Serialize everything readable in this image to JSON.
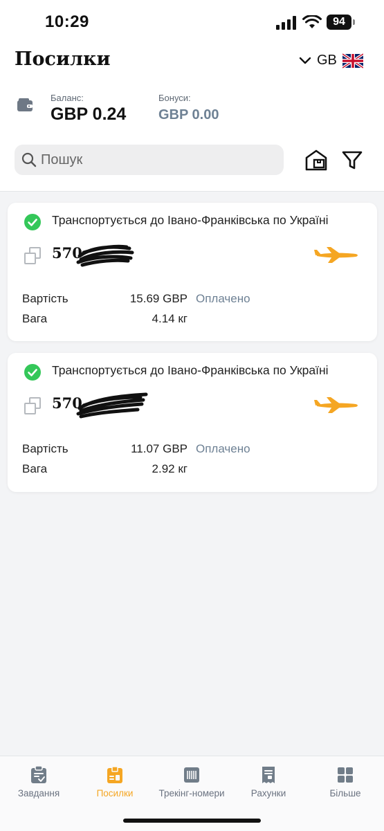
{
  "status_bar": {
    "time": "10:29",
    "battery": "94"
  },
  "header": {
    "title": "Посилки",
    "region_code": "GB"
  },
  "balance": {
    "label": "Баланс:",
    "value": "GBP 0.24"
  },
  "bonuses": {
    "label": "Бонуси:",
    "value": "GBP 0.00"
  },
  "search": {
    "placeholder": "Пошук"
  },
  "colors": {
    "accent": "#f5a623",
    "success": "#34c759",
    "muted": "#6e8194"
  },
  "parcels": [
    {
      "status": "Транспортується до Івано-Франківська по Україні",
      "tracking_visible": "570",
      "cost_label": "Вартість",
      "cost_value": "15.69 GBP",
      "payment_status": "Оплачено",
      "weight_label": "Вага",
      "weight_value": "4.14 кг"
    },
    {
      "status": "Транспортується до Івано-Франківська по Україні",
      "tracking_visible": "570",
      "cost_label": "Вартість",
      "cost_value": "11.07 GBP",
      "payment_status": "Оплачено",
      "weight_label": "Вага",
      "weight_value": "2.92 кг"
    }
  ],
  "tabs": [
    {
      "label": "Завдання",
      "icon": "tasks-icon",
      "active": false
    },
    {
      "label": "Посилки",
      "icon": "parcels-icon",
      "active": true
    },
    {
      "label": "Трекінг-номери",
      "icon": "barcode-icon",
      "active": false
    },
    {
      "label": "Рахунки",
      "icon": "invoice-icon",
      "active": false
    },
    {
      "label": "Більше",
      "icon": "grid-icon",
      "active": false
    }
  ]
}
